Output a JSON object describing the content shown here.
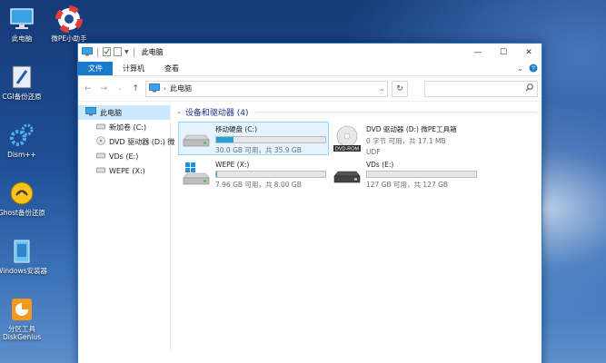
{
  "desktop": {
    "icons": [
      {
        "label": "此电脑",
        "icon": "computer-icon"
      },
      {
        "label": "微PE小助手",
        "icon": "lifebuoy-icon"
      },
      {
        "label": "CGI备份还原",
        "icon": "cgi-icon"
      },
      {
        "label": "Dism++",
        "icon": "gear-icon"
      },
      {
        "label": "Ghost备份还原",
        "icon": "ghost-icon"
      },
      {
        "label": "Windows安装器",
        "icon": "windows-installer-icon"
      },
      {
        "label": "分区工具\nDiskGenius",
        "icon": "diskgenius-icon"
      }
    ]
  },
  "window": {
    "title": "此电脑",
    "controls": {
      "minimize": "—",
      "maximize": "☐",
      "close": "✕"
    },
    "ribbon_tabs": [
      "文件",
      "计算机",
      "查看"
    ],
    "address": {
      "location": "此电脑"
    },
    "navpane": {
      "items": [
        {
          "label": "此电脑",
          "icon": "computer-icon"
        },
        {
          "label": "新加卷 (C:)",
          "icon": "drive-icon"
        },
        {
          "label": "DVD 驱动器 (D:) 微",
          "icon": "dvd-icon"
        },
        {
          "label": "VDs (E:)",
          "icon": "drive-icon"
        },
        {
          "label": "WEPE (X:)",
          "icon": "drive-icon"
        }
      ]
    },
    "content": {
      "group_title": "设备和驱动器 (4)",
      "drives": [
        {
          "name": "移动硬盘 (C:)",
          "size": "30.0 GB 可用，共 35.9 GB",
          "fill": 0.16,
          "icon": "hdd-icon"
        },
        {
          "name": "DVD 驱动器 (D:) 微PE工具箱",
          "size": "0 字节 可用，共 17.1 MB",
          "sub": "UDF",
          "icon": "dvd-rom-icon"
        },
        {
          "name": "WEPE (X:)",
          "size": "7.96 GB 可用，共 8.00 GB",
          "fill": 0.005,
          "icon": "windows-drive-icon"
        },
        {
          "name": "VDs (E:)",
          "size": "127 GB 可用，共 127 GB",
          "fill": 0.0,
          "icon": "hdd-icon"
        }
      ]
    }
  },
  "colors": {
    "accent": "#1979ca",
    "bar_fill": "#26a0da",
    "group_title": "#1e3287",
    "selection": "#cce8ff"
  }
}
